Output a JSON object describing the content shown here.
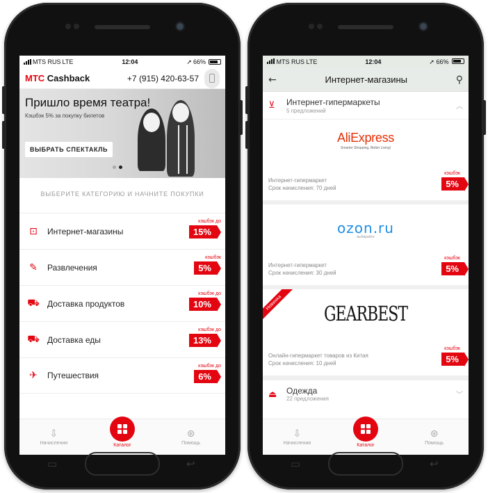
{
  "left": {
    "status": {
      "carrier": "MTS RUS",
      "network": "LTE",
      "time": "12:04",
      "battery": "66%"
    },
    "appbar": {
      "brand_mts": "МТС",
      "brand_name": "Cashback",
      "phone": "+7 (915) 420-63-57"
    },
    "banner": {
      "title": "Пришло время театра!",
      "subtitle": "Кэшбэк 5% за покупку билетов",
      "button": "ВЫБРАТЬ СПЕКТАКЛЬ"
    },
    "hint": "ВЫБЕРИТЕ КАТЕГОРИЮ И НАЧНИТЕ ПОКУПКИ",
    "categories": [
      {
        "label": "Интернет-магазины",
        "cashback_label": "кэшбэк до",
        "cashback": "15%",
        "icon": "basket-icon"
      },
      {
        "label": "Развлечения",
        "cashback_label": "кэшбэк",
        "cashback": "5%",
        "icon": "ticket-icon"
      },
      {
        "label": "Доставка продуктов",
        "cashback_label": "кэшбэк до",
        "cashback": "10%",
        "icon": "truck-icon"
      },
      {
        "label": "Доставка еды",
        "cashback_label": "кэшбэк до",
        "cashback": "13%",
        "icon": "truck-icon"
      },
      {
        "label": "Путешествия",
        "cashback_label": "кэшбэк до",
        "cashback": "6%",
        "icon": "plane-icon"
      }
    ],
    "tabs": {
      "accruals": "Начисления",
      "catalog": "Каталог",
      "help": "Помощь"
    }
  },
  "right": {
    "status": {
      "carrier": "MTS RUS",
      "network": "LTE",
      "time": "12:04",
      "battery": "66%"
    },
    "appbar": {
      "title": "Интернет-магазины"
    },
    "section": {
      "name": "Интернет-гипермаркеты",
      "count": "5 предложений"
    },
    "stores": [
      {
        "logo": "AliExpress",
        "logo_sub": "Smarter Shopping, Better Living!",
        "type": "Интернет-гипермаркет",
        "term": "Срок начисления: 70 дней",
        "cashback_label": "кэшбэк",
        "cashback": "5%"
      },
      {
        "logo": "ozon.ru",
        "logo_sub": "выбирайте",
        "type": "Интернет-гипермаркет",
        "term": "Срок начисления: 30 дней",
        "cashback_label": "кэшбэк",
        "cashback": "5%"
      },
      {
        "logo": "GEARBEST",
        "ribbon": "Новинка",
        "type": "Онлайн-гипермаркет товаров из Китая",
        "term": "Срок начисления: 10 дней",
        "cashback_label": "кэшбэк",
        "cashback": "5%"
      }
    ],
    "clothing": {
      "name": "Одежда",
      "count": "22 предложения"
    },
    "tabs": {
      "accruals": "Начисления",
      "catalog": "Каталог",
      "help": "Помощь"
    }
  },
  "colors": {
    "accent": "#e30611",
    "ozon": "#1e8de4",
    "aliexpress": "#e62e04"
  }
}
